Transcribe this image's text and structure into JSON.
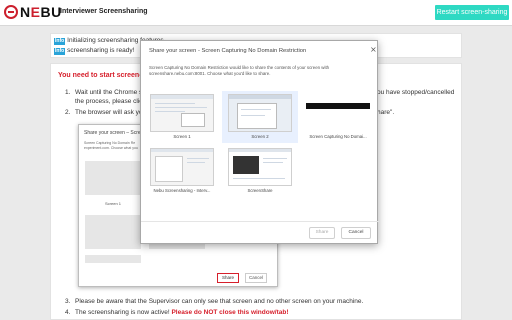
{
  "header": {
    "logo_text_a": "N",
    "logo_text_o": "E",
    "logo_text_b": "BU",
    "title": "Interviewer Screensharing",
    "restart_label": "Restart screen-sharing"
  },
  "info": {
    "badge": "Info",
    "line1": "Initializing screensharing features...",
    "line2": "screensharing is ready!"
  },
  "main": {
    "heading": "You need to start screen-sh",
    "step1_num": "1.",
    "step1_a": "Wait until the Chrome scr",
    "step1_a_right": "ou have stopped/cancelled",
    "step1_b": "the process, please click",
    "step2_num": "2.",
    "step2_a": "The browser will ask you",
    "step2_a_right": "hare\".",
    "step3_num": "3.",
    "step3": "Please be aware that the Supervisor can only see that screen and no other screen on your machine.",
    "step4_num": "4.",
    "step4_a": "The screensharing is now active! ",
    "step4_warn": "Please do NOT close this window/tab!"
  },
  "tutorial_dialog": {
    "title": "Share your screen – Screen",
    "desc": "Screen Capturing No Domain Re",
    "desc2": "experiment.com. Choose what you",
    "screen_label": "Screen 1",
    "share": "Share",
    "cancel": "Cancel"
  },
  "dialog": {
    "title": "Share your screen - Screen Capturing No Domain Restriction",
    "close": "×",
    "desc": "Screen Capturing No Domain Restriction would like to share the contents of your screen with screenshare.nebu.com:8001. Choose what you'd like to share.",
    "tiles": [
      {
        "label": "Screen 1"
      },
      {
        "label": "Screen 2"
      },
      {
        "label": "Screen Capturing No Domai..."
      },
      {
        "label": "Nebu Screensharing - Interv..."
      },
      {
        "label": "ScreenShare"
      }
    ],
    "share_label": "Share",
    "cancel_label": "Cancel"
  },
  "colors": {
    "brand_red": "#cc1f2d",
    "accent_teal": "#2ed9c3",
    "info_badge": "#29a3d8"
  }
}
